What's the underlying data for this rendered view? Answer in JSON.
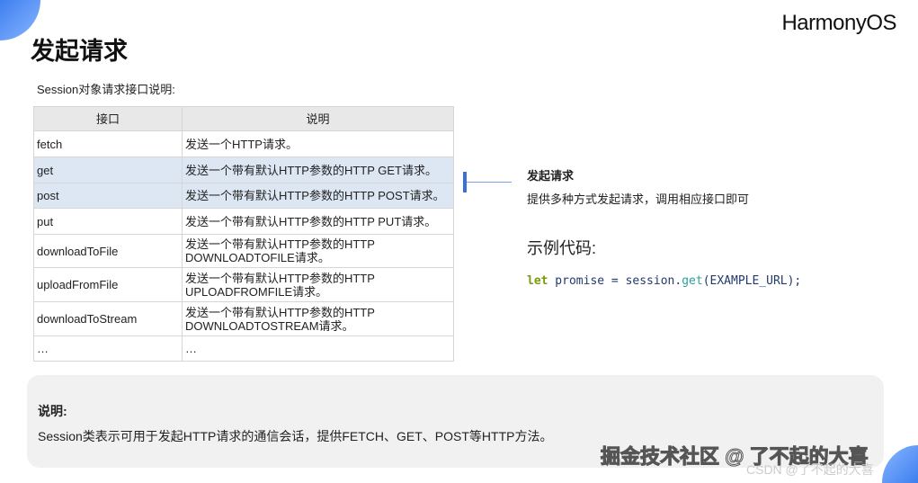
{
  "logo": "HarmonyOS",
  "title": "发起请求",
  "subtitle": "Session对象请求接口说明:",
  "table": {
    "headers": [
      "接口",
      "说明"
    ],
    "rows": [
      {
        "api": "fetch",
        "desc": "发送一个HTTP请求。"
      },
      {
        "api": "get",
        "desc": "发送一个带有默认HTTP参数的HTTP GET请求。"
      },
      {
        "api": "post",
        "desc": "发送一个带有默认HTTP参数的HTTP POST请求。"
      },
      {
        "api": "put",
        "desc": "发送一个带有默认HTTP参数的HTTP PUT请求。"
      },
      {
        "api": "downloadToFile",
        "desc": "发送一个带有默认HTTP参数的HTTP DOWNLOADTOFILE请求。"
      },
      {
        "api": "uploadFromFile",
        "desc": "发送一个带有默认HTTP参数的HTTP UPLOADFROMFILE请求。"
      },
      {
        "api": "downloadToStream",
        "desc": "发送一个带有默认HTTP参数的HTTP DOWNLOADTOSTREAM请求。"
      },
      {
        "api": "…",
        "desc": "…"
      }
    ]
  },
  "callout": {
    "title": "发起请求",
    "desc": "提供多种方式发起请求，调用相应接口即可"
  },
  "code": {
    "title": "示例代码:",
    "kw": "let",
    "pre": " promise = session.",
    "fn": "get",
    "post": "(EXAMPLE_URL);"
  },
  "note": {
    "title": "说明:",
    "body": "Session类表示可用于发起HTTP请求的通信会话，提供FETCH、GET、POST等HTTP方法。"
  },
  "watermark": {
    "main": "掘金技术社区 @ 了不起的大喜",
    "sub": "CSDN @了不起的大喜"
  }
}
